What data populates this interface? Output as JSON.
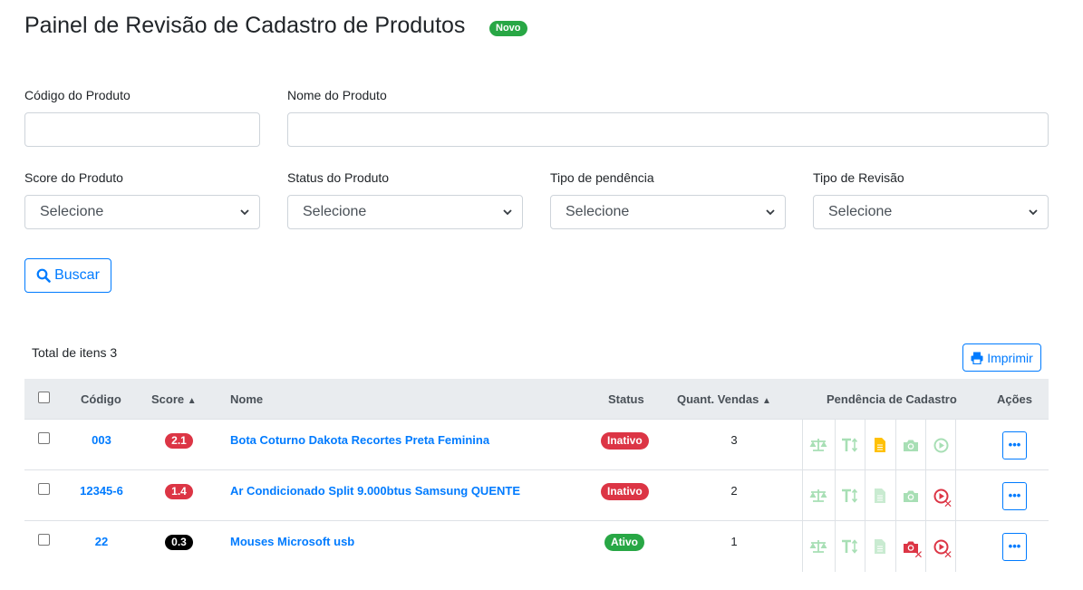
{
  "page": {
    "title": "Painel de Revisão de Cadastro de Produtos",
    "badge": "Novo"
  },
  "filters": {
    "codigo_label": "Código do Produto",
    "codigo_value": "",
    "nome_label": "Nome do Produto",
    "nome_value": "",
    "score_label": "Score do Produto",
    "score_value": "Selecione",
    "status_label": "Status do Produto",
    "status_value": "Selecione",
    "pendencia_label": "Tipo de pendência",
    "pendencia_value": "Selecione",
    "revisao_label": "Tipo de Revisão",
    "revisao_value": "Selecione",
    "search_button": "Buscar"
  },
  "summary": {
    "total_label": "Total de itens 3",
    "print_button": "Imprimir"
  },
  "table": {
    "headers": {
      "codigo": "Código",
      "score": "Score",
      "nome": "Nome",
      "status": "Status",
      "quant_vendas": "Quant. Vendas",
      "pendencia": "Pendência de Cadastro",
      "acoes": "Ações"
    },
    "rows": [
      {
        "codigo": "003",
        "score": "2.1",
        "nome": "Bota Coturno Dakota Recortes Preta Feminina",
        "status": "Inativo",
        "quant_vendas": "3",
        "acoes": "•••"
      },
      {
        "codigo": "12345-6",
        "score": "1.4",
        "nome": "Ar Condicionado Split 9.000btus Samsung QUENTE",
        "status": "Inativo",
        "quant_vendas": "2",
        "acoes": "•••"
      },
      {
        "codigo": "22",
        "score": "0.3",
        "nome": "Mouses Microsoft usb",
        "status": "Ativo",
        "quant_vendas": "1",
        "acoes": "•••"
      }
    ]
  },
  "colors": {
    "primary": "#007bff",
    "success": "#28a745",
    "danger": "#dc3545",
    "warning": "#ffc107",
    "muted_icon": "#a8dfb5",
    "header_bg": "#e9ecef"
  },
  "icons": {
    "pendencia_columns": [
      "balance-scale-icon",
      "text-height-icon",
      "file-icon",
      "camera-icon",
      "play-circle-icon"
    ]
  }
}
